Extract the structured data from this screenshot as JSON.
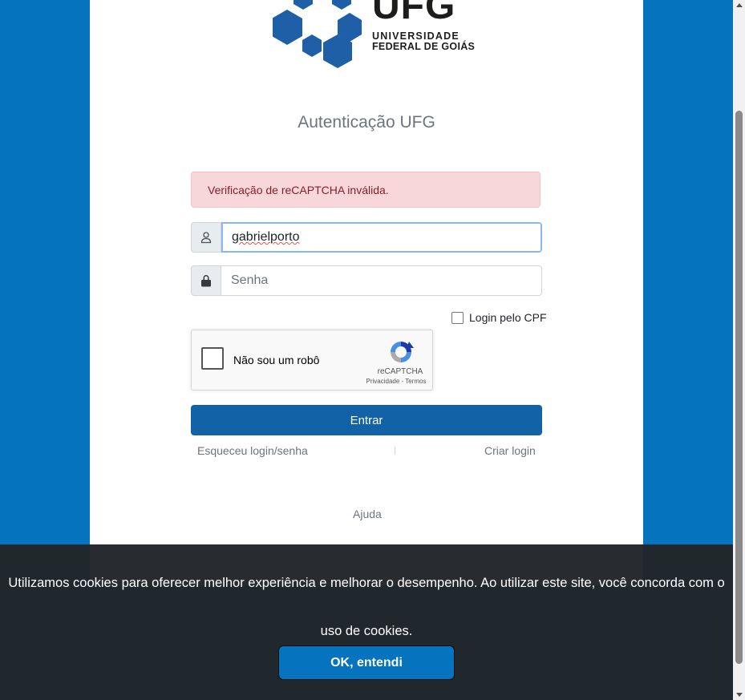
{
  "logo": {
    "word": "UFG",
    "line1": "UNIVERSIDADE",
    "line2": "FEDERAL DE GOIÁS"
  },
  "title": "Autenticação UFG",
  "alert": "Verificação de reCAPTCHA inválida.",
  "login": {
    "username_value": "gabrielporto",
    "password_placeholder": "Senha",
    "cpf_label": "Login pelo CPF"
  },
  "recaptcha": {
    "label": "Não sou um robô",
    "brand": "reCAPTCHA",
    "links": "Privacidade - Termos"
  },
  "buttons": {
    "submit": "Entrar"
  },
  "links": {
    "forgot": "Esqueceu login/senha",
    "create": "Criar login",
    "help": "Ajuda"
  },
  "cookie": {
    "text": "Utilizamos cookies para oferecer melhor experiência e melhorar o desempenho. Ao utilizar este site, você concorda com o uso de cookies.",
    "button": "OK, entendi"
  },
  "colors": {
    "background": "#0573bd",
    "primary_button": "#1262a8",
    "alert_bg": "#f8d7da",
    "alert_text": "#842029",
    "logo_blue": "#1f5fa8"
  },
  "icons": [
    "user-icon",
    "lock-icon",
    "recaptcha-icon"
  ]
}
